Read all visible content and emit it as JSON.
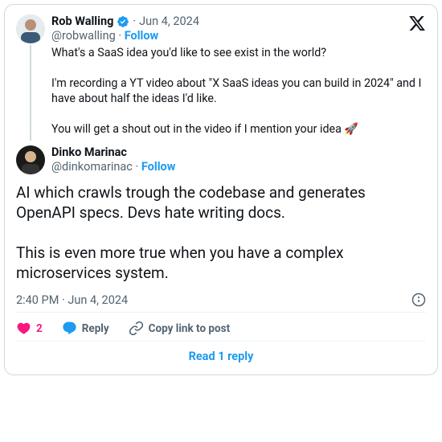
{
  "quoted": {
    "author_name": "Rob Walling",
    "author_handle": "@robwalling",
    "follow_label": "Follow",
    "date": "Jun 4, 2024",
    "text": "What's a SaaS idea you'd like to see exist in the world?\n\nI'm recording a YT video about \"X SaaS ideas you can build in 2024\" and I have about half the ideas I'd like.\n\nYou will get a shout out in the video if I mention your idea 🚀"
  },
  "reply": {
    "author_name": "Dinko Marinac",
    "author_handle": "@dinkomarinac",
    "follow_label": "Follow",
    "text": "AI which crawls trough the codebase and generates OpenAPI specs. Devs hate writing docs.\n\nThis is even more true when you have a complex microservices system."
  },
  "timestamp": "2:40 PM · Jun 4, 2024",
  "actions": {
    "like_count": "2",
    "reply_label": "Reply",
    "copy_label": "Copy link to post"
  },
  "read_more": "Read 1 reply",
  "sep": " · "
}
